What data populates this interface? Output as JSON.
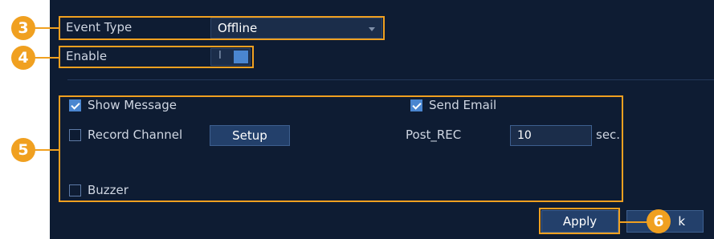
{
  "event_type": {
    "label": "Event Type",
    "value": "Offline"
  },
  "enable": {
    "label": "Enable",
    "toggle_text": "I",
    "on": true
  },
  "options": {
    "show_message": {
      "label": "Show Message",
      "checked": true
    },
    "send_email": {
      "label": "Send Email",
      "checked": true
    },
    "record_channel": {
      "label": "Record Channel",
      "checked": false
    },
    "setup_label": "Setup",
    "post_rec": {
      "label": "Post_REC",
      "value": "10",
      "unit": "sec."
    },
    "buzzer": {
      "label": "Buzzer",
      "checked": false
    }
  },
  "actions": {
    "apply_label": "Apply",
    "back_label_partial": "k"
  },
  "callouts": [
    "3",
    "4",
    "5",
    "6"
  ],
  "colors": {
    "accent": "#f0a020",
    "panel_bg": "#0e1c33",
    "toggle_blue": "#4a86d0"
  }
}
